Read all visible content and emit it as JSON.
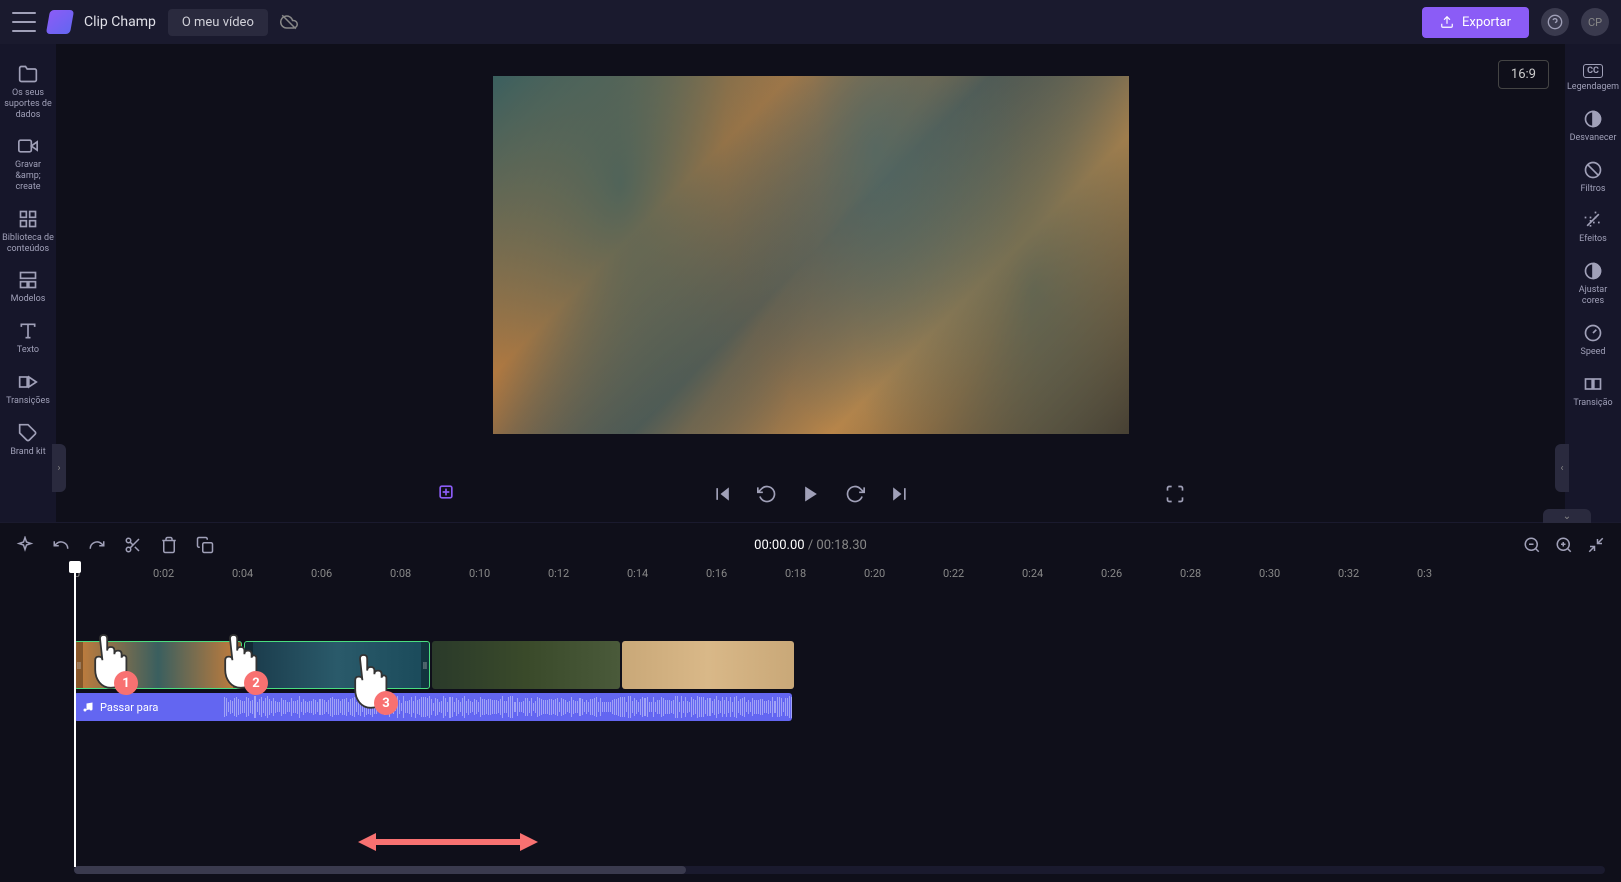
{
  "header": {
    "brand": "Clip Champ",
    "title": "O meu vídeo",
    "export": "Exportar",
    "avatar": "CP"
  },
  "left_sidebar": {
    "items": [
      {
        "label": "Os seus suportes de dados"
      },
      {
        "label": "Gravar &amp;\ncreate"
      },
      {
        "label": "Biblioteca de conteúdos"
      },
      {
        "label": "Modelos"
      },
      {
        "label": "Texto"
      },
      {
        "label": "Transições"
      },
      {
        "label": "Brand kit"
      }
    ]
  },
  "right_sidebar": {
    "items": [
      {
        "label": "Legendagem"
      },
      {
        "label": "Desvanecer"
      },
      {
        "label": "Filtros"
      },
      {
        "label": "Efeitos"
      },
      {
        "label": "Ajustar cores"
      },
      {
        "label": "Speed"
      },
      {
        "label": "Transição"
      }
    ]
  },
  "preview": {
    "aspect": "16:9"
  },
  "timeline": {
    "current": "00:00.00",
    "total": "00:18.30",
    "ruler": [
      "0",
      "0:02",
      "0:04",
      "0:06",
      "0:08",
      "0:10",
      "0:12",
      "0:14",
      "0:16",
      "0:18",
      "0:20",
      "0:22",
      "0:24",
      "0:26",
      "0:28",
      "0:30",
      "0:32",
      "0:3"
    ],
    "audio_label": "Passar para"
  },
  "annotations": {
    "n1": "1",
    "n2": "2",
    "n3": "3"
  }
}
